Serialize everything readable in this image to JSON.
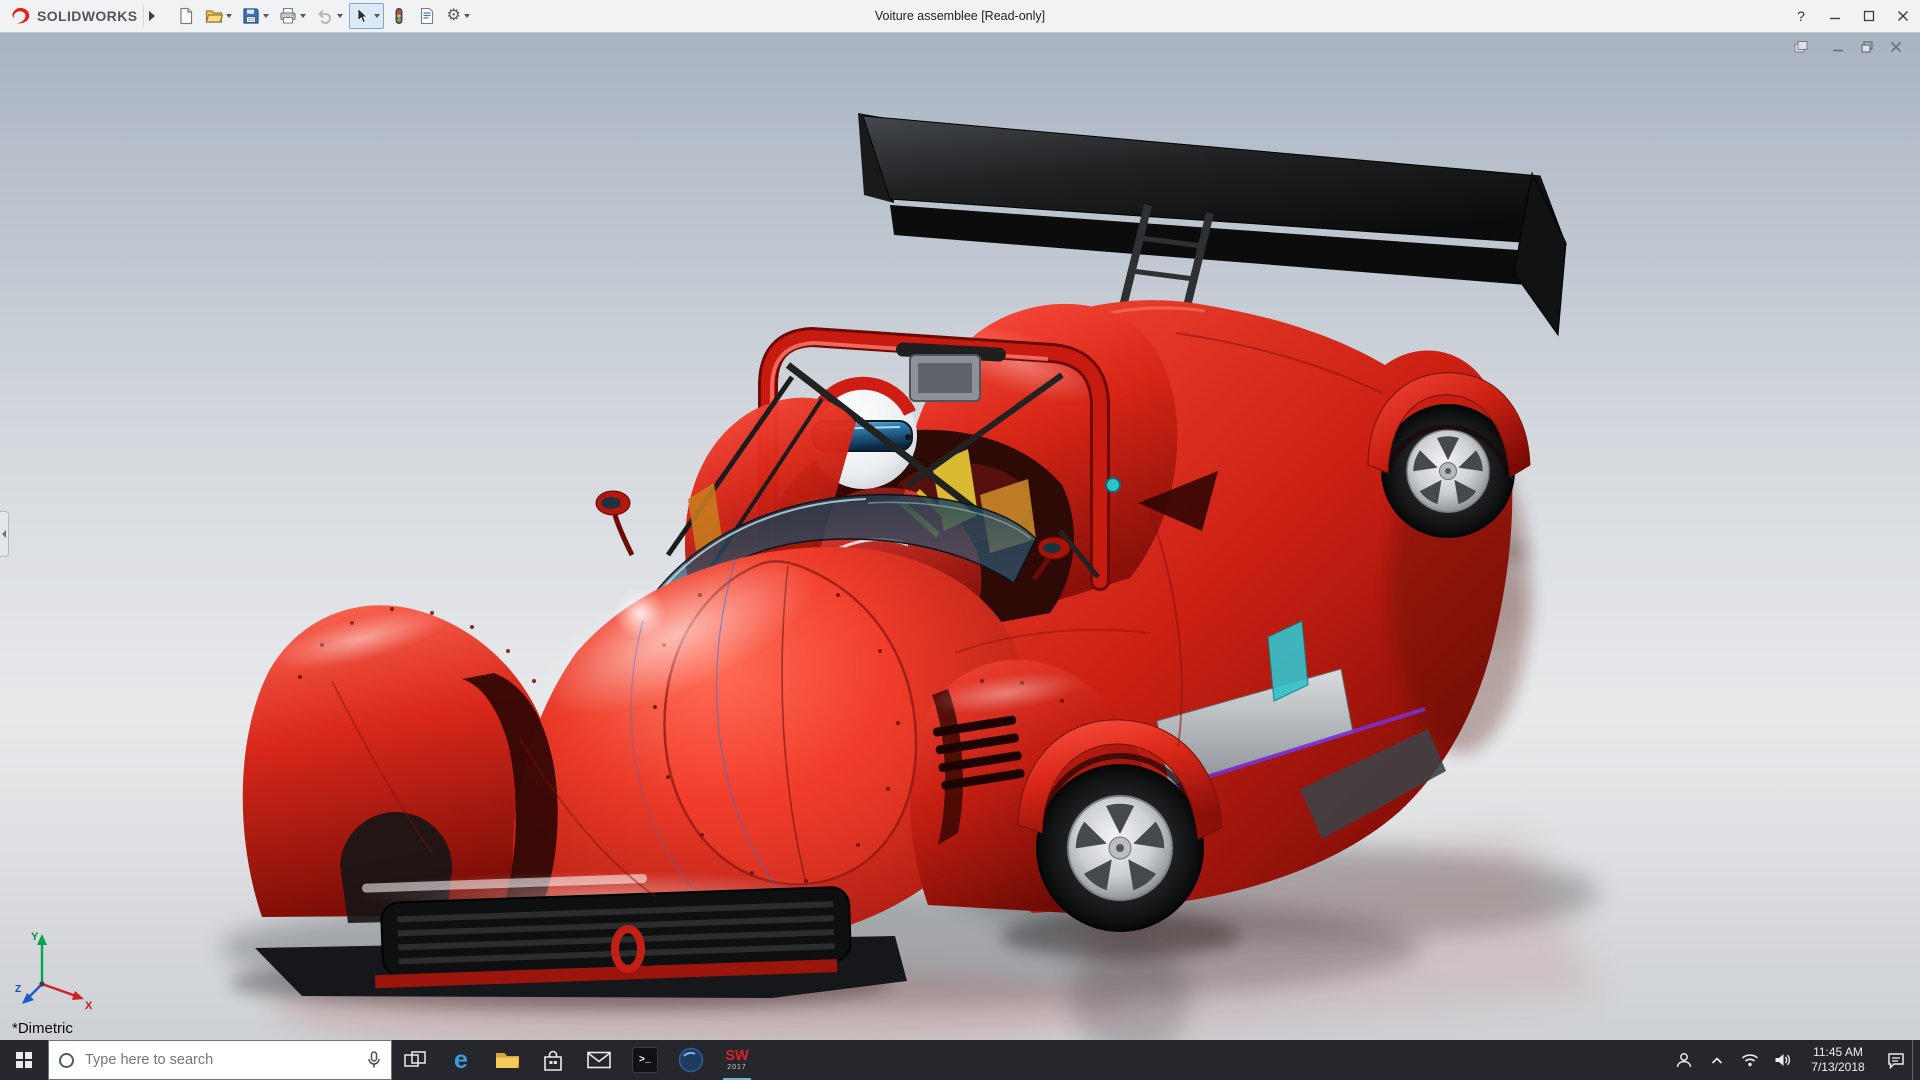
{
  "window": {
    "title": "Voiture assemblee [Read-only]",
    "help_glyph": "?"
  },
  "brand": {
    "name": "SOLIDWORKS"
  },
  "toolbar": {
    "gear_glyph": "⚙",
    "items": [
      "new-document",
      "open",
      "save",
      "print",
      "undo",
      "select",
      "rebuild",
      "file-properties",
      "options"
    ]
  },
  "viewport": {
    "view_label": "*Dimetric",
    "triad": {
      "x": "X",
      "y": "Y",
      "z": "Z"
    }
  },
  "taskbar": {
    "search_placeholder": "Type here to search",
    "edge_glyph": "e",
    "console_glyph": ">_",
    "solidworks_mark": "SW",
    "solidworks_year": "2017",
    "tray": {
      "time": "11:45 AM",
      "date": "7/13/2018"
    }
  },
  "colors": {
    "titlebar-bg": "#f1f2f4",
    "taskbar-bg": "#25272c",
    "body-red": "#d0211a",
    "body-red-bright": "#ff4a3a",
    "body-red-dark": "#7e0e07",
    "wing-black": "#17181a",
    "visor-blue": "#2d7fae",
    "accent-teal": "#2cc3cb",
    "accent-purple": "#7b2fd0",
    "accent-yellow": "#e2c433",
    "helmet-white": "#f2f4f6",
    "running-indicator": "#76b0d8"
  }
}
